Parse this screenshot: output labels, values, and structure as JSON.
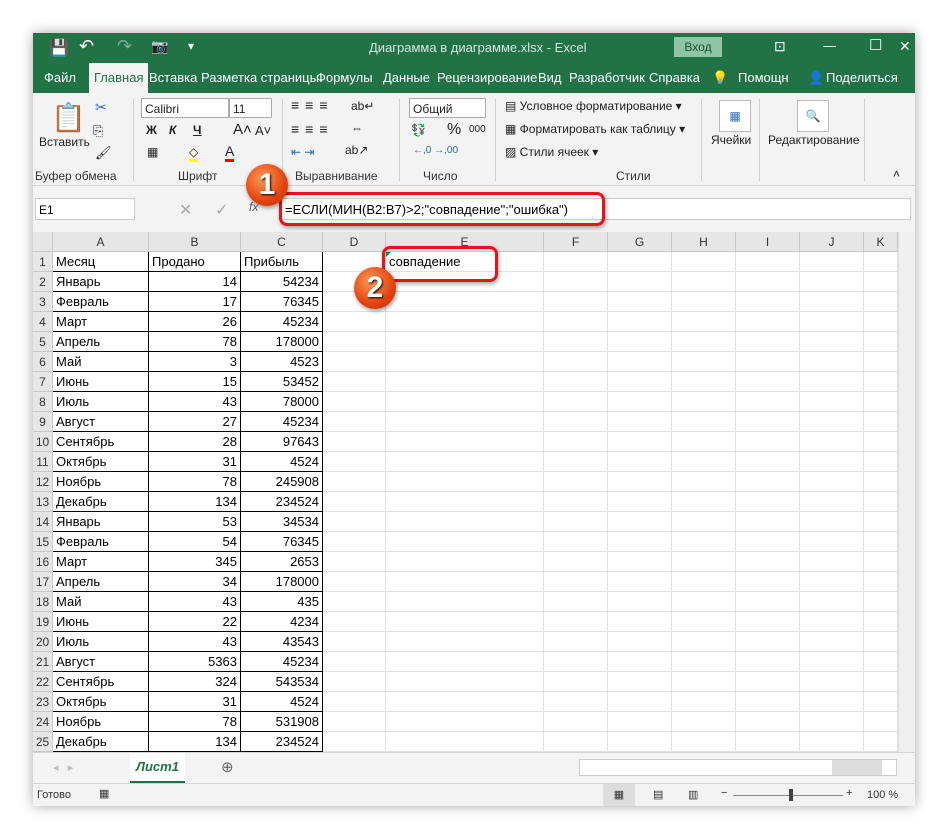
{
  "title": {
    "text": "Диаграмма в диаграмме.xlsx  -  Excel",
    "signin": "Вход",
    "minimize": "—",
    "maximize": "☐",
    "close": "✕"
  },
  "tabs": [
    "Файл",
    "Главная",
    "Вставка",
    "Разметка страницы",
    "Формулы",
    "Данные",
    "Рецензирование",
    "Вид",
    "Разработчик",
    "Справка"
  ],
  "tell_me": "Помощн",
  "share": "Поделиться",
  "ribbon": {
    "paste": "Вставить",
    "clipboard": "Буфер обмена",
    "font_name": "Calibri",
    "font_size": "11",
    "bold": "Ж",
    "italic": "К",
    "underline": "Ч",
    "font": "Шрифт",
    "alignment": "Выравнивание",
    "number_format": "Общий",
    "percent": "%",
    "thousands": "000",
    "number": "Число",
    "cond_format": "Условное форматирование",
    "format_table": "Форматировать как таблицу",
    "cell_styles": "Стили ячеек",
    "styles": "Стили",
    "cells": "Ячейки",
    "editing": "Редактирование"
  },
  "formula_bar": {
    "name_box": "E1",
    "fx": "fx",
    "formula": "=ЕСЛИ(МИН(B2:B7)>2;\"совпадение\";\"ошибка\")"
  },
  "columns": [
    "A",
    "B",
    "C",
    "D",
    "E",
    "F",
    "G",
    "H",
    "I",
    "J",
    "K"
  ],
  "header_row": [
    "Месяц",
    "Продано",
    "Прибыль"
  ],
  "e1": "совпадение",
  "rows": [
    [
      "Январь",
      14,
      54234
    ],
    [
      "Февраль",
      17,
      76345
    ],
    [
      "Март",
      26,
      45234
    ],
    [
      "Апрель",
      78,
      178000
    ],
    [
      "Май",
      3,
      4523
    ],
    [
      "Июнь",
      15,
      53452
    ],
    [
      "Июль",
      43,
      78000
    ],
    [
      "Август",
      27,
      45234
    ],
    [
      "Сентябрь",
      28,
      97643
    ],
    [
      "Октябрь",
      31,
      4524
    ],
    [
      "Ноябрь",
      78,
      245908
    ],
    [
      "Декабрь",
      134,
      234524
    ],
    [
      "Январь",
      53,
      34534
    ],
    [
      "Февраль",
      54,
      76345
    ],
    [
      "Март",
      345,
      2653
    ],
    [
      "Апрель",
      34,
      178000
    ],
    [
      "Май",
      43,
      435
    ],
    [
      "Июнь",
      22,
      4234
    ],
    [
      "Июль",
      43,
      43543
    ],
    [
      "Август",
      5363,
      45234
    ],
    [
      "Сентябрь",
      324,
      543534
    ],
    [
      "Октябрь",
      31,
      4524
    ],
    [
      "Ноябрь",
      78,
      531908
    ],
    [
      "Декабрь",
      134,
      234524
    ]
  ],
  "badges": [
    "1",
    "2"
  ],
  "sheet_tab": "Лист1",
  "status": {
    "ready": "Готово",
    "zoom": "100 %"
  },
  "colors": {
    "accent": "#217346",
    "highlight": "#e8131a"
  }
}
